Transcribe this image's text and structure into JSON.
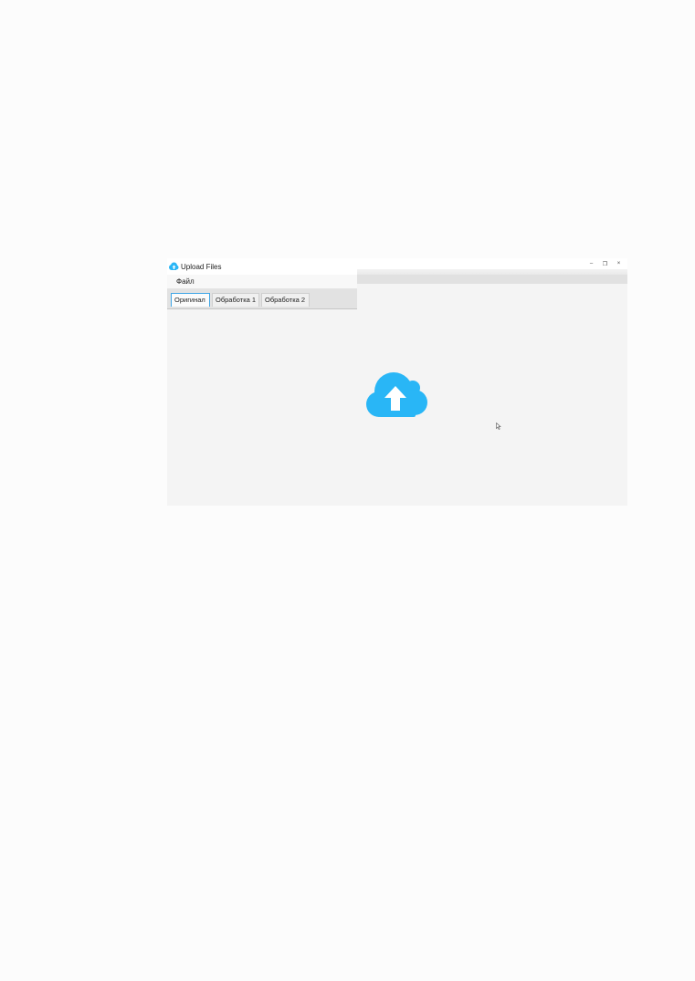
{
  "window": {
    "title": "Upload Files",
    "controls": {
      "minimize": "–",
      "maximize": "❐",
      "close": "×"
    }
  },
  "menu": {
    "items": [
      {
        "label": "Файл"
      }
    ]
  },
  "tabs": [
    {
      "label": "Оригинал",
      "active": true
    },
    {
      "label": "Обработка 1",
      "active": false
    },
    {
      "label": "Обработка 2",
      "active": false
    }
  ],
  "upload": {
    "icon": "cloud-upload-icon"
  },
  "colors": {
    "accent": "#29b6f6",
    "tab_focus_border": "#3fa6e6",
    "window_background": "#f4f4f4",
    "page_background": "#fcfcfc"
  }
}
